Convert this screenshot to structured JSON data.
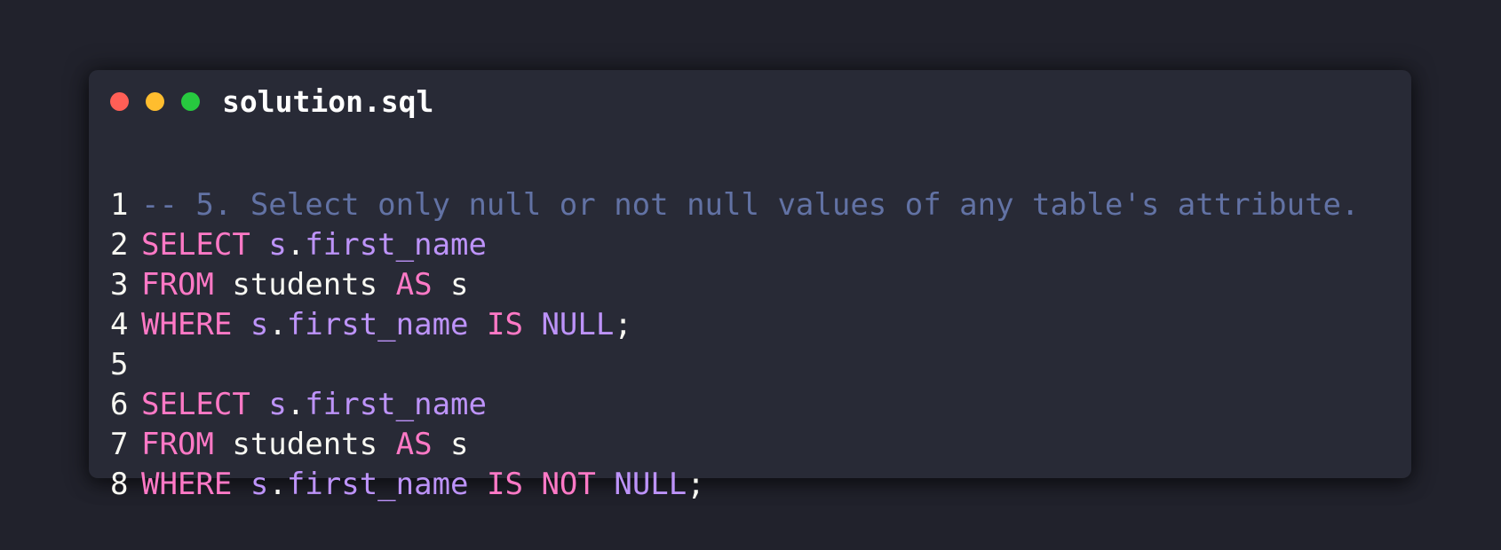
{
  "window": {
    "filename": "solution.sql",
    "traffic_lights": [
      {
        "name": "close",
        "color": "#ff5f56"
      },
      {
        "name": "minimize",
        "color": "#ffbd2e"
      },
      {
        "name": "maximize",
        "color": "#27c93f"
      }
    ]
  },
  "colors": {
    "background": "#21222c",
    "window_bg": "#282a36",
    "comment": "#6272a4",
    "keyword": "#ff79c6",
    "identifier": "#bd93f9",
    "plain": "#f8f8f2"
  },
  "code": {
    "lines": [
      {
        "number": "1",
        "tokens": [
          {
            "type": "comment",
            "text": "-- 5. Select only null or not null values of any table's attribute."
          }
        ]
      },
      {
        "number": "2",
        "tokens": [
          {
            "type": "keyword",
            "text": "SELECT"
          },
          {
            "type": "plain",
            "text": " "
          },
          {
            "type": "identifier",
            "text": "s"
          },
          {
            "type": "plain",
            "text": "."
          },
          {
            "type": "identifier",
            "text": "first_name"
          }
        ]
      },
      {
        "number": "3",
        "tokens": [
          {
            "type": "keyword",
            "text": "FROM"
          },
          {
            "type": "plain",
            "text": " students "
          },
          {
            "type": "keyword",
            "text": "AS"
          },
          {
            "type": "plain",
            "text": " s"
          }
        ]
      },
      {
        "number": "4",
        "tokens": [
          {
            "type": "keyword",
            "text": "WHERE"
          },
          {
            "type": "plain",
            "text": " "
          },
          {
            "type": "identifier",
            "text": "s"
          },
          {
            "type": "plain",
            "text": "."
          },
          {
            "type": "identifier",
            "text": "first_name"
          },
          {
            "type": "plain",
            "text": " "
          },
          {
            "type": "keyword",
            "text": "IS"
          },
          {
            "type": "plain",
            "text": " "
          },
          {
            "type": "identifier",
            "text": "NULL"
          },
          {
            "type": "plain",
            "text": ";"
          }
        ]
      },
      {
        "number": "5",
        "tokens": []
      },
      {
        "number": "6",
        "tokens": [
          {
            "type": "keyword",
            "text": "SELECT"
          },
          {
            "type": "plain",
            "text": " "
          },
          {
            "type": "identifier",
            "text": "s"
          },
          {
            "type": "plain",
            "text": "."
          },
          {
            "type": "identifier",
            "text": "first_name"
          }
        ]
      },
      {
        "number": "7",
        "tokens": [
          {
            "type": "keyword",
            "text": "FROM"
          },
          {
            "type": "plain",
            "text": " students "
          },
          {
            "type": "keyword",
            "text": "AS"
          },
          {
            "type": "plain",
            "text": " s"
          }
        ]
      },
      {
        "number": "8",
        "tokens": [
          {
            "type": "keyword",
            "text": "WHERE"
          },
          {
            "type": "plain",
            "text": " "
          },
          {
            "type": "identifier",
            "text": "s"
          },
          {
            "type": "plain",
            "text": "."
          },
          {
            "type": "identifier",
            "text": "first_name"
          },
          {
            "type": "plain",
            "text": " "
          },
          {
            "type": "keyword",
            "text": "IS"
          },
          {
            "type": "plain",
            "text": " "
          },
          {
            "type": "keyword",
            "text": "NOT"
          },
          {
            "type": "plain",
            "text": " "
          },
          {
            "type": "identifier",
            "text": "NULL"
          },
          {
            "type": "plain",
            "text": ";"
          }
        ]
      }
    ]
  }
}
